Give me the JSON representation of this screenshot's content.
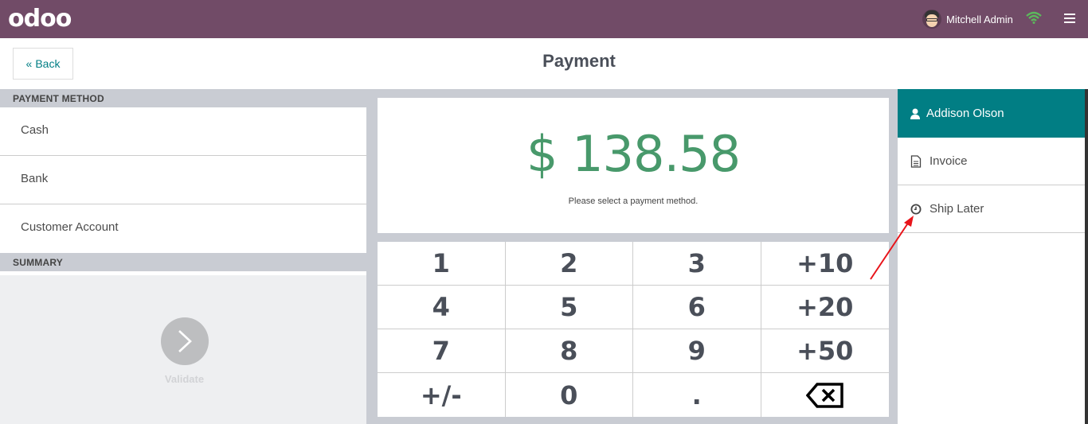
{
  "navbar": {
    "logo": "odoo",
    "user_name": "Mitchell Admin",
    "wifi_icon": "wifi-icon",
    "menu_icon": "hamburger-menu-icon",
    "brand_color": "#714b67",
    "wifi_color": "#5cb85c"
  },
  "control_bar": {
    "back_icon": "double-chevron-left-icon",
    "back_label": "Back",
    "title": "Payment"
  },
  "payment_methods": {
    "section_title": "PAYMENT METHOD",
    "items": [
      {
        "label": "Cash"
      },
      {
        "label": "Bank"
      },
      {
        "label": "Customer Account"
      }
    ]
  },
  "summary": {
    "section_title": "SUMMARY"
  },
  "validate": {
    "icon": "chevron-right-icon",
    "label": "Validate"
  },
  "amount": {
    "value": "$ 138.58",
    "hint": "Please select a payment method.",
    "color": "#48996b"
  },
  "numpad": {
    "keys": [
      "1",
      "2",
      "3",
      "+10",
      "4",
      "5",
      "6",
      "+20",
      "7",
      "8",
      "9",
      "+50",
      "+/-",
      "0",
      ".",
      "backspace"
    ]
  },
  "right_panel": {
    "customer": {
      "icon": "user-icon",
      "label": "Addison Olson",
      "color": "#017e84"
    },
    "invoice": {
      "icon": "file-text-icon",
      "label": "Invoice"
    },
    "ship_later": {
      "icon": "clock-icon",
      "label": "Ship Later"
    }
  }
}
